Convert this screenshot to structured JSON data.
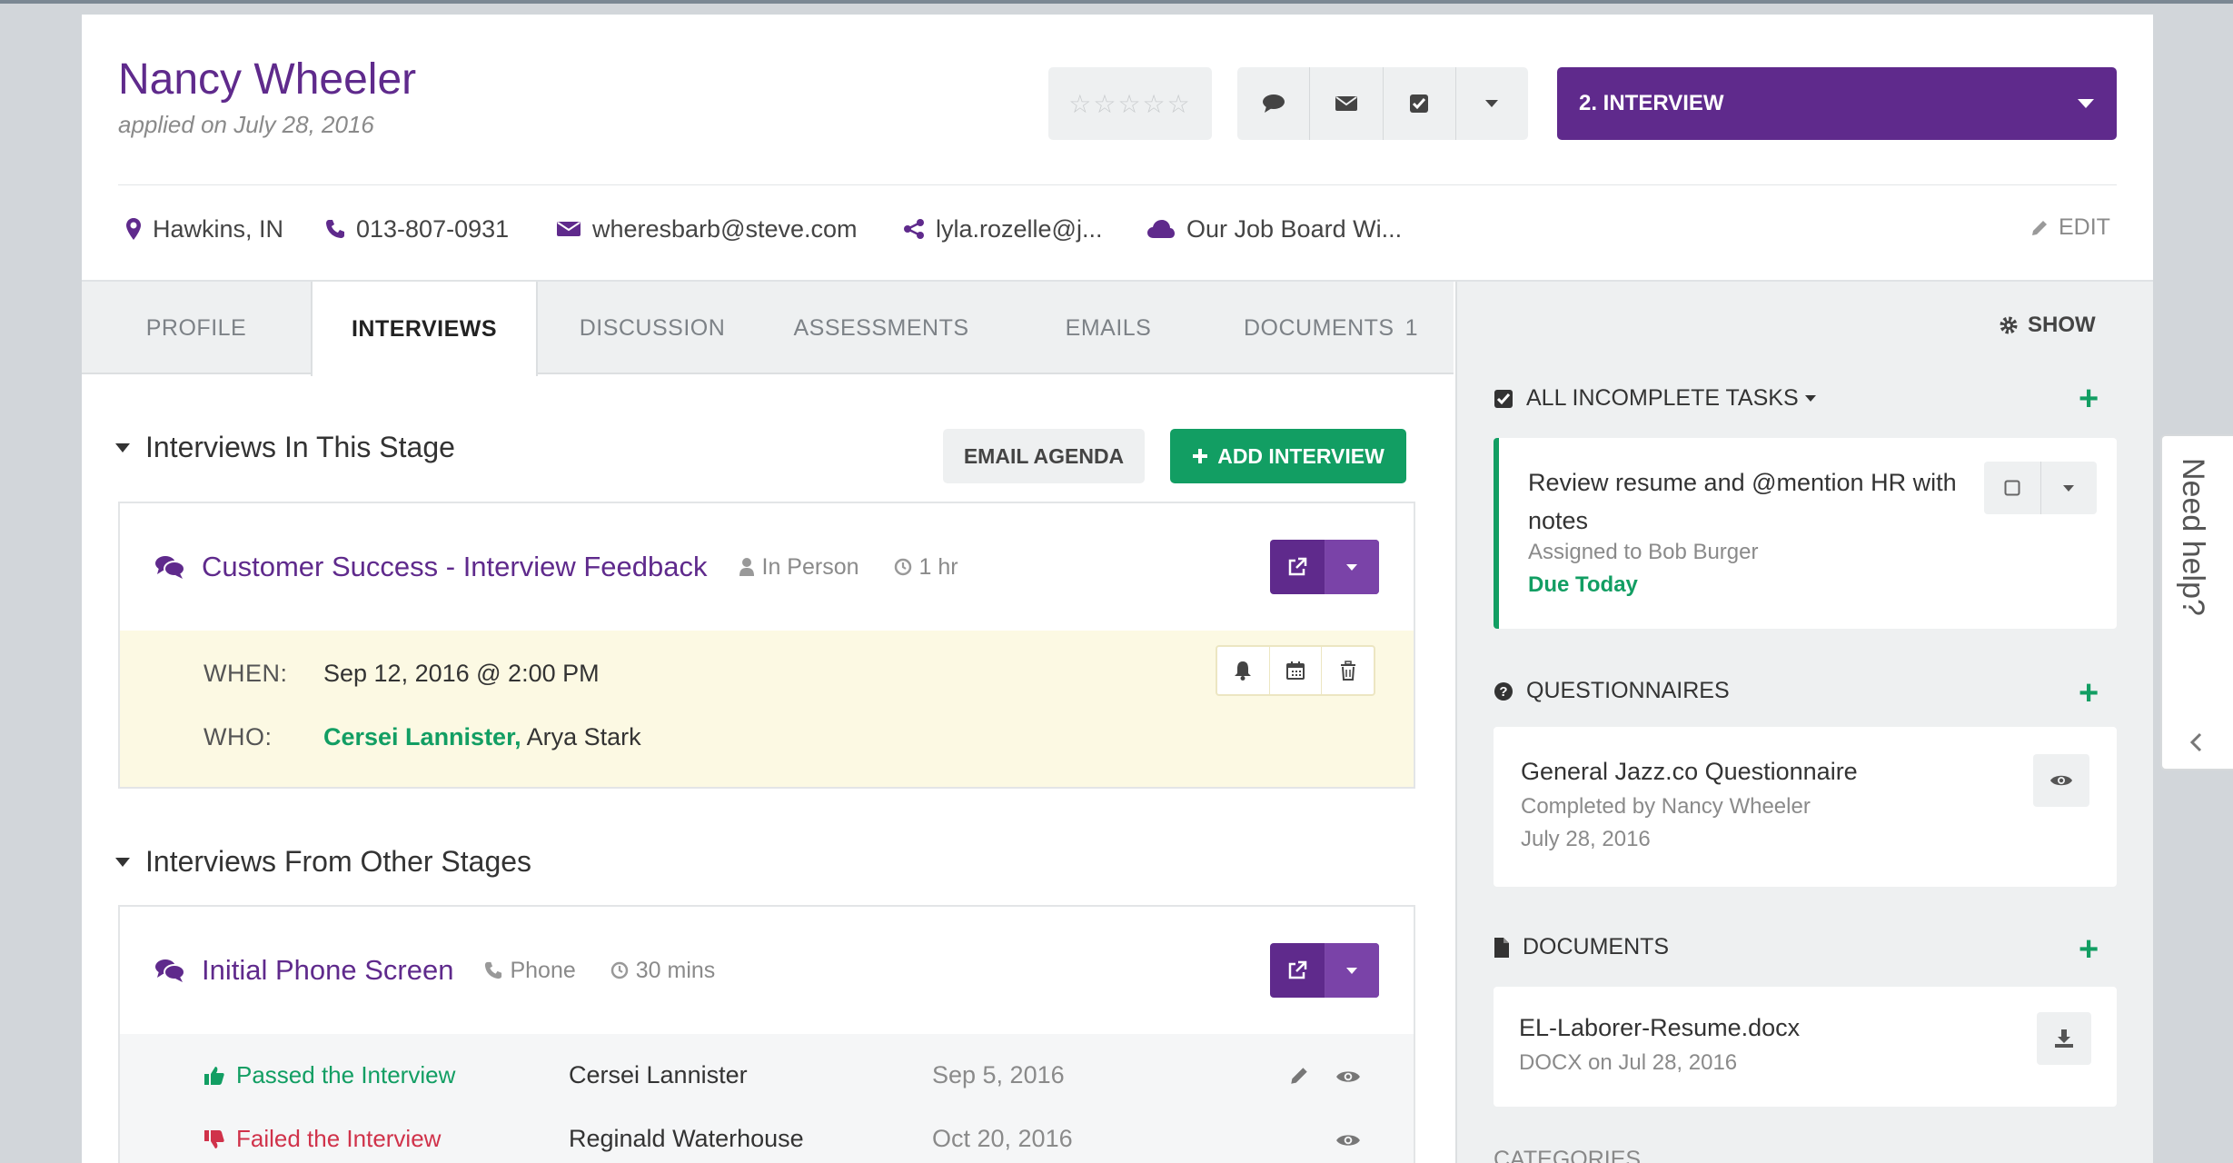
{
  "candidate": {
    "name": "Nancy Wheeler",
    "applied": "applied on July 28, 2016"
  },
  "header": {
    "stars": "☆☆☆☆☆",
    "stage": "2. INTERVIEW"
  },
  "contact": {
    "location": "Hawkins, IN",
    "phone": "013-807-0931",
    "email": "wheresbarb@steve.com",
    "referral": "lyla.rozelle@j...",
    "source": "Our Job Board Wi...",
    "edit": "EDIT"
  },
  "tabs": [
    {
      "label": "PROFILE"
    },
    {
      "label": "INTERVIEWS"
    },
    {
      "label": "DISCUSSION"
    },
    {
      "label": "ASSESSMENTS"
    },
    {
      "label": "EMAILS"
    },
    {
      "label": "DOCUMENTS",
      "count": "1"
    }
  ],
  "show": "SHOW",
  "section_this_stage": {
    "title": "Interviews In This Stage",
    "email_agenda": "EMAIL AGENDA",
    "add_interview": "ADD INTERVIEW",
    "interview": {
      "title": "Customer Success - Interview Feedback",
      "type": "In Person",
      "duration": "1 hr",
      "when_label": "WHEN:",
      "when": "Sep 12, 2016 @ 2:00 PM",
      "who_label": "WHO:",
      "who_green": "Cersei Lannister,",
      "who_rest": "Arya Stark"
    }
  },
  "section_other_stages": {
    "title": "Interviews From Other Stages",
    "interview": {
      "title": "Initial Phone Screen",
      "type": "Phone",
      "duration": "30 mins",
      "results": [
        {
          "result": "Passed the Interview",
          "interviewer": "Cersei Lannister",
          "date": "Sep 5, 2016",
          "status": "passed"
        },
        {
          "result": "Failed the Interview",
          "interviewer": "Reginald Waterhouse",
          "date": "Oct 20, 2016",
          "status": "failed"
        }
      ]
    }
  },
  "sidebar": {
    "tasks": {
      "title": "ALL INCOMPLETE TASKS",
      "task_line1": "Review resume and @mention HR with",
      "task_line2": "notes",
      "assigned": "Assigned to Bob Burger",
      "due": "Due Today"
    },
    "questionnaires": {
      "title": "QUESTIONNAIRES",
      "name": "General Jazz.co Questionnaire",
      "completed_by": "Completed by Nancy Wheeler",
      "date": "July 28, 2016"
    },
    "documents": {
      "title": "DOCUMENTS",
      "file": "EL-Laborer-Resume.docx",
      "meta": "DOCX on Jul 28, 2016"
    },
    "categories": {
      "title": "CATEGORIES"
    }
  },
  "need_help": "Need help?",
  "colors": {
    "purple": "#5f2a8c",
    "green": "#129e63",
    "red": "#d0324a",
    "yellow_bg": "#fcf9e3"
  }
}
